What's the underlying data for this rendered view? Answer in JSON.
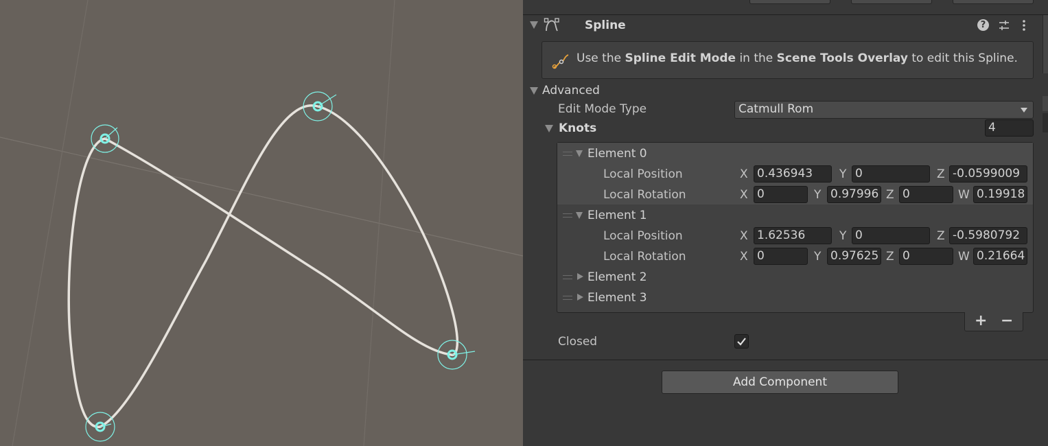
{
  "component": {
    "title": "Spline",
    "help_text_pre": "Use the ",
    "help_text_b1": "Spline Edit Mode",
    "help_text_mid": " in the ",
    "help_text_b2": "Scene Tools Overlay",
    "help_text_post": " to edit this Spline."
  },
  "advanced": {
    "label": "Advanced",
    "edit_mode_label": "Edit Mode Type",
    "edit_mode_value": "Catmull Rom",
    "knots_label": "Knots",
    "knots_count": "4"
  },
  "elements": [
    {
      "label": "Element 0",
      "pos_label": "Local Position",
      "rot_label": "Local Rotation",
      "pos": {
        "x": "0.436943",
        "y": "0",
        "z": "-0.0599009"
      },
      "rot": {
        "x": "0",
        "y": "0.97996",
        "z": "0",
        "w": "0.19918"
      }
    },
    {
      "label": "Element 1",
      "pos_label": "Local Position",
      "rot_label": "Local Rotation",
      "pos": {
        "x": "1.62536",
        "y": "0",
        "z": "-0.5980792"
      },
      "rot": {
        "x": "0",
        "y": "0.97625",
        "z": "0",
        "w": "0.21664"
      }
    },
    {
      "label": "Element 2"
    },
    {
      "label": "Element 3"
    }
  ],
  "axes": {
    "x": "X",
    "y": "Y",
    "z": "Z",
    "w": "W"
  },
  "list_buttons": {
    "add": "+",
    "remove": "−"
  },
  "closed": {
    "label": "Closed",
    "checked": true
  },
  "add_component_label": "Add Component",
  "icons": [
    "spline-component-icon",
    "help-icon",
    "preset-icon",
    "kebab-menu-icon",
    "spline-tool-icon",
    "checkmark-icon"
  ],
  "colors": {
    "scene_bg": "#67615b",
    "inspector_bg": "#383838",
    "spline": "#e6e2dc",
    "knot": "#7ff2e6",
    "accent_icon": "#e9a23b"
  }
}
